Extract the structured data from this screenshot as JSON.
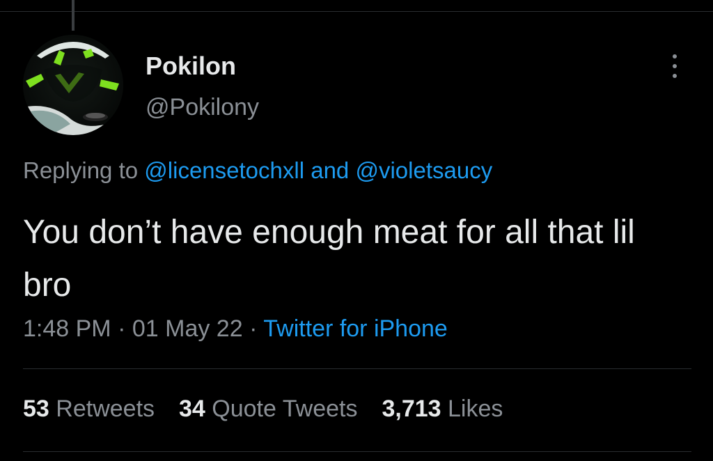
{
  "author": {
    "display_name": "Pokilon",
    "handle": "@Pokilony"
  },
  "reply": {
    "prefix": "Replying to",
    "mentions": [
      "@licensetochxll",
      "@violetsaucy"
    ],
    "joiner": "and"
  },
  "tweet": {
    "text": "You don’t have enough meat for all that lil bro"
  },
  "meta": {
    "time": "1:48 PM",
    "separator": "·",
    "date": "01 May 22",
    "source": "Twitter for iPhone"
  },
  "stats": {
    "retweets_count": "53",
    "retweets_label": "Retweets",
    "quotes_count": "34",
    "quotes_label": "Quote Tweets",
    "likes_count": "3,713",
    "likes_label": "Likes"
  },
  "icons": {
    "more": "more-vertical-icon",
    "avatar": "avatar-image"
  },
  "colors": {
    "background": "#000000",
    "text_primary": "#e7e9ea",
    "text_secondary": "#8b9096",
    "link": "#1d9bf0",
    "divider": "#2a2d30"
  }
}
